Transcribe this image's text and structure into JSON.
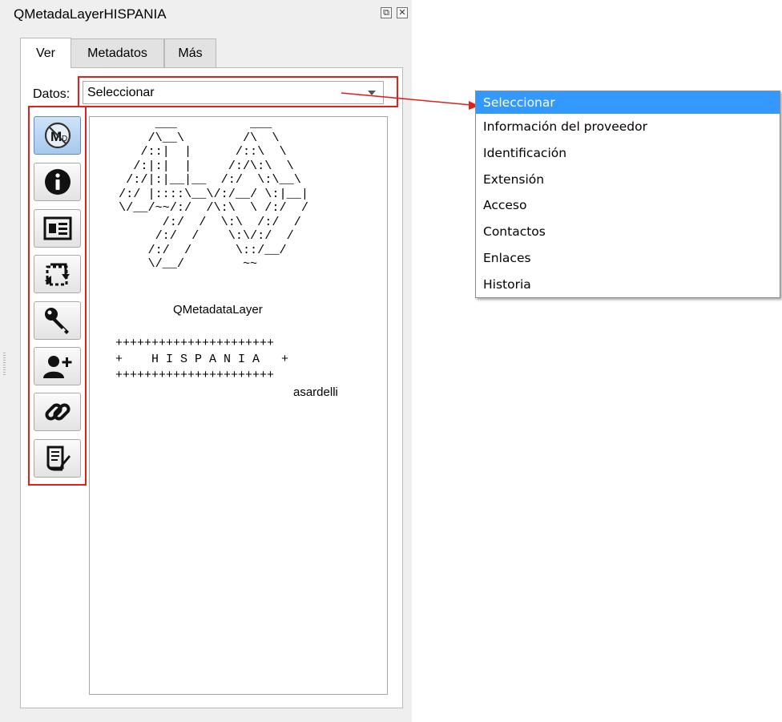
{
  "panel": {
    "title": "QMetadaLayerHISPANIA",
    "float_icon": "⧉",
    "close_icon": "✕"
  },
  "tabs": [
    {
      "label": "Ver",
      "active": true
    },
    {
      "label": "Metadatos",
      "active": false
    },
    {
      "label": "Más",
      "active": false
    }
  ],
  "datos": {
    "label": "Datos:",
    "selected": "Seleccionar"
  },
  "toolbar": [
    {
      "name": "md-button",
      "icon": "metadata-md-icon",
      "active": true
    },
    {
      "name": "info-button",
      "icon": "info-icon",
      "active": false
    },
    {
      "name": "identification-button",
      "icon": "id-card-icon",
      "active": false
    },
    {
      "name": "extent-button",
      "icon": "extent-icon",
      "active": false
    },
    {
      "name": "access-button",
      "icon": "key-icon",
      "active": false
    },
    {
      "name": "contacts-button",
      "icon": "add-user-icon",
      "active": false
    },
    {
      "name": "links-button",
      "icon": "link-icon",
      "active": false
    },
    {
      "name": "history-button",
      "icon": "scroll-icon",
      "active": false
    }
  ],
  "content": {
    "ascii_art": "     ___          ___\n    /\\__\\        /\\  \\\n   /::|  |      /::\\  \\\n  /:|:|  |     /:/\\:\\  \\\n /:/|:|__|__  /:/  \\:\\__\\\n/:/ |::::\\__\\/:/__/ \\:|__|\n\\/__/~~/:/  /\\:\\  \\ /:/  /\n      /:/  /  \\:\\  /:/  /\n     /:/  /    \\:\\/:/  /\n    /:/  /      \\::/__/\n    \\/__/        ~~",
    "app_name": "QMetadataLayer",
    "banner_line1": "++++++++++++++++++++++",
    "banner_line2": "+    H I S P A N I A   +",
    "banner_line3": "++++++++++++++++++++++",
    "author": "asardelli"
  },
  "dropdown": {
    "items": [
      "Seleccionar",
      "Información del proveedor",
      "Identificación",
      "Extensión",
      "Acceso",
      "Contactos",
      "Enlaces",
      "Historia"
    ],
    "selected_index": 0
  },
  "colors": {
    "highlight": "#3399ff",
    "annotation_red": "#e0201c"
  }
}
